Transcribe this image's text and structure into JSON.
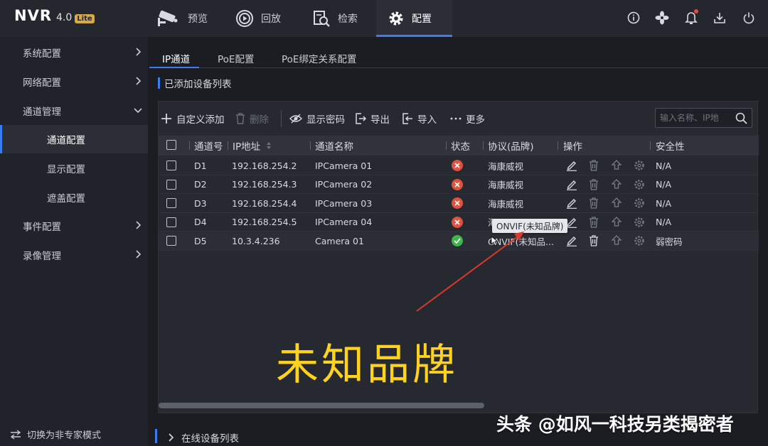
{
  "header": {
    "logo_main": "NVR",
    "logo_version": "4.0",
    "logo_badge": "Lite",
    "tabs": [
      {
        "label": "预览",
        "icon": "camera-icon"
      },
      {
        "label": "回放",
        "icon": "playback-icon"
      },
      {
        "label": "检索",
        "icon": "search-doc-icon"
      },
      {
        "label": "配置",
        "icon": "gear-icon",
        "active": true
      }
    ],
    "right_icons": [
      "info-icon",
      "fan-icon",
      "bell-icon",
      "download-icon",
      "power-icon"
    ]
  },
  "sidebar": {
    "items": [
      {
        "label": "系统配置",
        "expandable": true,
        "expanded": false
      },
      {
        "label": "网络配置",
        "expandable": true,
        "expanded": false
      },
      {
        "label": "通道管理",
        "expandable": true,
        "expanded": true
      },
      {
        "label": "通道配置",
        "sub": true,
        "active": true
      },
      {
        "label": "显示配置",
        "sub": true
      },
      {
        "label": "遮盖配置",
        "sub": true
      },
      {
        "label": "事件配置",
        "expandable": true,
        "expanded": false
      },
      {
        "label": "录像管理",
        "expandable": true,
        "expanded": false
      }
    ],
    "footer": "切换为非专家模式"
  },
  "subtabs": [
    {
      "label": "IP通道",
      "active": true
    },
    {
      "label": "PoE配置"
    },
    {
      "label": "PoE绑定关系配置"
    }
  ],
  "section_title": "已添加设备列表",
  "toolbar": {
    "add": "自定义添加",
    "delete": "删除",
    "show_password": "显示密码",
    "export": "导出",
    "import": "导入",
    "more": "更多",
    "search_placeholder": "输入名称、IP地"
  },
  "table": {
    "headers": [
      "通道号",
      "IP地址",
      "通道名称",
      "状态",
      "协议(品牌)",
      "操作",
      "安全性"
    ],
    "rows": [
      {
        "channel": "D1",
        "ip": "192.168.254.2",
        "name": "IPCamera 01",
        "status": "offline",
        "protocol": "海康威视",
        "security": "N/A"
      },
      {
        "channel": "D2",
        "ip": "192.168.254.3",
        "name": "IPCamera 02",
        "status": "offline",
        "protocol": "海康威视",
        "security": "N/A"
      },
      {
        "channel": "D3",
        "ip": "192.168.254.4",
        "name": "IPCamera 03",
        "status": "offline",
        "protocol": "海康威视",
        "security": "N/A"
      },
      {
        "channel": "D4",
        "ip": "192.168.254.5",
        "name": "IPCamera 04",
        "status": "offline",
        "protocol": "海",
        "security": "N/A"
      },
      {
        "channel": "D5",
        "ip": "10.3.4.236",
        "name": "Camera 01",
        "status": "online",
        "protocol": "ONVIF(未知品...",
        "security": "弱密码"
      }
    ]
  },
  "tooltip": "ONVIF(未知品牌)",
  "annotation": "未知品牌",
  "online_section_title": "在线设备列表",
  "watermark": "头条 @如风一科技另类揭密者",
  "colors": {
    "accent": "#3c7bf2",
    "offline": "#e0523d",
    "online": "#3eb64a",
    "annotation": "#ffd21e",
    "arrow": "#d93a2b"
  }
}
